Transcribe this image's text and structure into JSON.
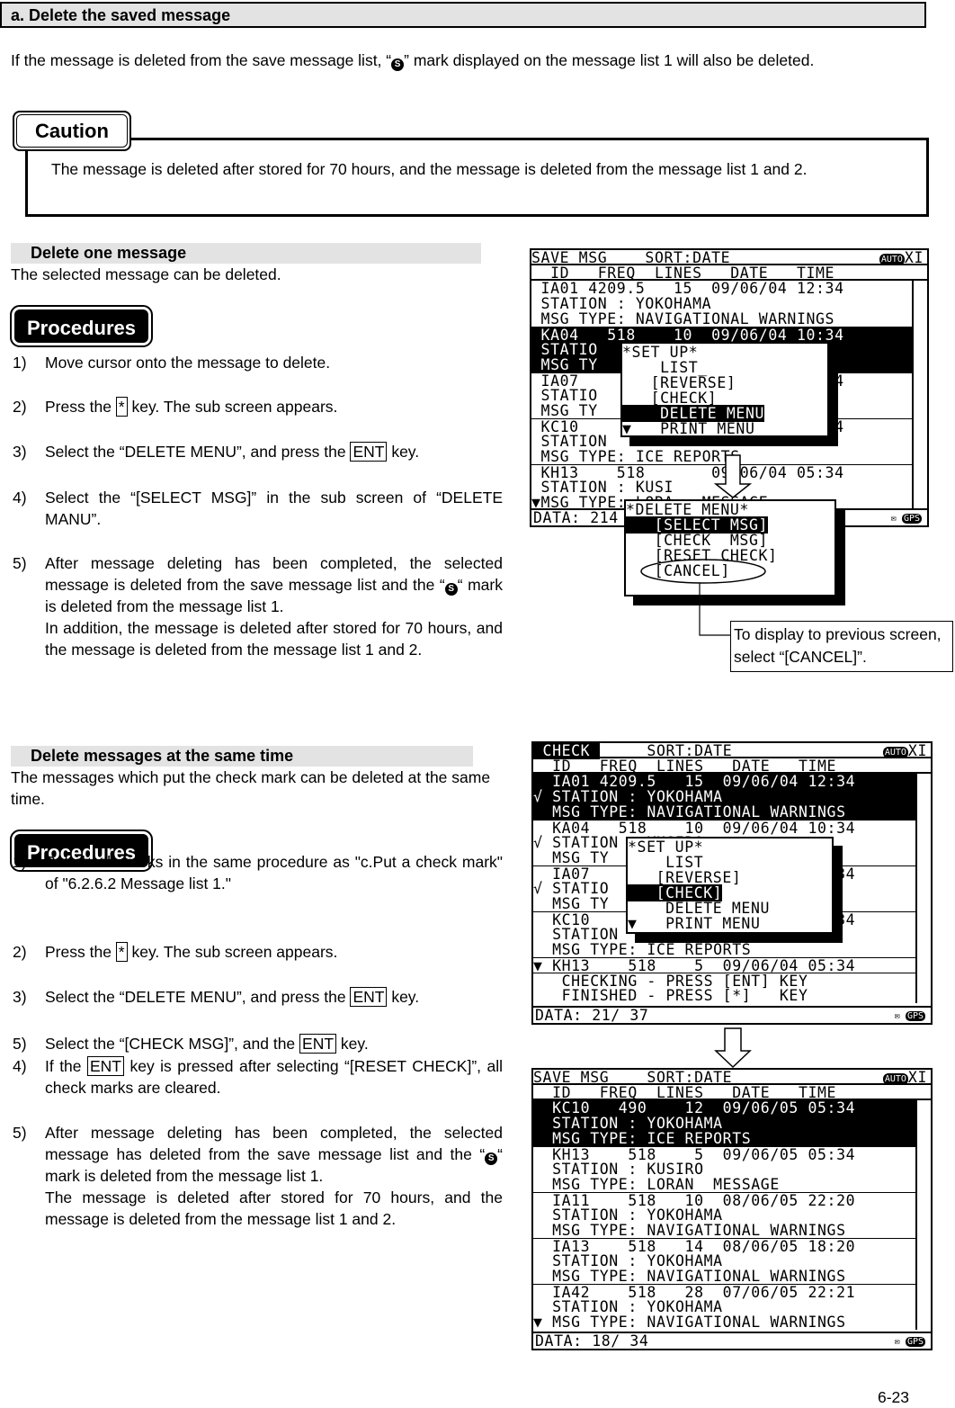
{
  "section_title": "a. Delete the saved message",
  "intro": {
    "before": "If the message is deleted from the save message list, “",
    "mark": "S",
    "after": "” mark displayed on the message list 1 will also be deleted."
  },
  "caution": {
    "label": "Caution",
    "text": "The message is deleted after stored for 70 hours, and the message is deleted from the message list 1 and 2."
  },
  "delete_one": {
    "heading": "Delete one message",
    "desc": "The selected message can be deleted.",
    "procedures_label": "Procedures",
    "steps": [
      {
        "num": "1)",
        "text": "Move cursor onto the message to delete."
      },
      {
        "num": "2)",
        "pre": "Press the ",
        "key": "*",
        "post": " key. The sub screen appears."
      },
      {
        "num": "3)",
        "pre": "Select the “DELETE MENU”, and press the ",
        "key": "ENT",
        "post": " key."
      },
      {
        "num": "4)",
        "text": "Select the “[SELECT MSG]” in the sub screen of “DELETE MANU”."
      },
      {
        "num": "5)",
        "pre": "After message deleting has been completed, the selected message is deleted from the save message list and the “",
        "post": "“ mark is deleted from the message list 1.",
        "extra": "In addition, the message is deleted after stored for 70 hours, and the message is deleted from the message list 1 and 2."
      }
    ]
  },
  "delete_multi": {
    "heading": "Delete messages at the same time",
    "desc": "The messages which put the check mark can be deleted at the same time.",
    "procedures_label": "Procedures",
    "steps": [
      {
        "num": "1)",
        "text": "Put check marks in the same procedure as \"c.Put a check mark\" of \"6.2.6.2 Message list 1.\""
      },
      {
        "num": "2)",
        "pre": "Press the ",
        "key": "*",
        "post": " key. The sub screen appears."
      },
      {
        "num": "3)",
        "pre": "Select the “DELETE MENU”, and press the ",
        "key": "ENT",
        "post": " key."
      },
      {
        "num": "5)",
        "pre": "Select the “[CHECK MSG]”, and the ",
        "key": "ENT",
        "post": " key."
      },
      {
        "num": "4)",
        "pre": "If the ",
        "key": "ENT",
        "post": " key is pressed after selecting “[RESET CHECK]”, all check marks are cleared."
      },
      {
        "num": "5)",
        "pre": "After message deleting has been completed, the selected message has deleted from the save message list and the “",
        "post": "“ mark is deleted from the message list 1.",
        "extra": "The message is deleted after stored for 70 hours, and the message is deleted from the message list 1 and 2."
      }
    ]
  },
  "screens": [
    {
      "title_inv": "",
      "title": "SAVE MSG    SORT:DATE",
      "auto": "AUTO",
      "mode": "XI",
      "header": "  ID   FREQ  LINES   DATE   TIME",
      "rows": [
        {
          "t": " IA01 4209.5   15  09/06/04 12:34"
        },
        {
          "t": " STATION : YOKOHAMA"
        },
        {
          "t": " MSG TYPE: NAVIGATIONAL WARNINGS"
        },
        {
          "t": " KA04   518    10  09/06/04 10:34",
          "inv": true,
          "sep": true
        },
        {
          "t": " STATIO",
          "inv": true
        },
        {
          "t": " MSG TY                  RNINGS",
          "inv": true
        },
        {
          "t": " IA07                       09:34",
          "sep": true
        },
        {
          "t": " STATIO"
        },
        {
          "t": " MSG TY                  RNINGS"
        },
        {
          "t": " KC10                       05:34",
          "sep": true
        },
        {
          "t": " STATION"
        },
        {
          "t": " MSG TYPE: ICE REPORTS"
        },
        {
          "t": " KH13    518       09/06/04 05:34",
          "sep": true
        },
        {
          "t": " STATION : KUSI"
        },
        {
          "t": "▼MSG TYPE: LORA   MESSAGE"
        }
      ],
      "footer": "DATA: 214",
      "gps": "GPS"
    },
    {
      "title_inv": " CHECK ",
      "title": "     SORT:DATE",
      "auto": "AUTO",
      "mode": "XI",
      "header": "  ID   FREQ  LINES   DATE   TIME",
      "rows": [
        {
          "t": "  IA01 4209.5   15  09/06/04 12:34",
          "inv": true
        },
        {
          "t": "√ STATION : YOKOHAMA",
          "inv": true
        },
        {
          "t": "  MSG TYPE: NAVIGATIONAL WARNINGS",
          "inv": true
        },
        {
          "t": "  KA04   518    10  09/06/04 10:34",
          "sep": true
        },
        {
          "t": "√ STATION : KUSIRO"
        },
        {
          "t": "  MSG TY                  RNINGS"
        },
        {
          "t": "  IA07                       09:34",
          "sep": true
        },
        {
          "t": "√ STATIO"
        },
        {
          "t": "  MSG TY                  RNINGS"
        },
        {
          "t": "  KC10                       05:34",
          "sep": true
        },
        {
          "t": "  STATION"
        },
        {
          "t": "  MSG TYPE: ICE REPORTS"
        },
        {
          "t": "▼ KH13    518    5  09/06/04 05:34",
          "sep": true
        },
        {
          "t": "   CHECKING - PRESS [ENT] KEY",
          "sep": true
        },
        {
          "t": "   FINISHED - PRESS [*]   KEY"
        }
      ],
      "footer": "DATA: 21/ 37",
      "gps": "GPS"
    },
    {
      "title_inv": "",
      "title": "SAVE MSG    SORT:DATE",
      "auto": "AUTO",
      "mode": "XI",
      "header": "  ID   FREQ  LINES   DATE   TIME",
      "rows": [
        {
          "t": "  KC10   490    12  09/06/05 05:34",
          "inv": true
        },
        {
          "t": "  STATION : YOKOHAMA",
          "inv": true
        },
        {
          "t": "  MSG TYPE: ICE REPORTS",
          "inv": true
        },
        {
          "t": "  KH13    518    5  09/06/05 05:34",
          "sep": true
        },
        {
          "t": "  STATION : KUSIRO"
        },
        {
          "t": "  MSG TYPE: LORAN  MESSAGE"
        },
        {
          "t": "  IA11    518   10  08/06/05 22:20",
          "sep": true
        },
        {
          "t": "  STATION : YOKOHAMA"
        },
        {
          "t": "  MSG TYPE: NAVIGATIONAL WARNINGS"
        },
        {
          "t": "  IA13    518   14  08/06/05 18:20",
          "sep": true
        },
        {
          "t": "  STATION : YOKOHAMA"
        },
        {
          "t": "  MSG TYPE: NAVIGATIONAL WARNINGS"
        },
        {
          "t": "  IA42    518   28  07/06/05 22:21",
          "sep": true
        },
        {
          "t": "  STATION : YOKOHAMA"
        },
        {
          "t": "▼ MSG TYPE: NAVIGATIONAL WARNINGS"
        }
      ],
      "footer": "DATA: 18/ 34",
      "gps": "GPS"
    }
  ],
  "popups": [
    {
      "lines": [
        {
          "t": "*SET UP*"
        },
        {
          "t": "    LIST_"
        },
        {
          "t": "   [REVERSE]"
        },
        {
          "t": "   [CHECK]"
        },
        {
          "t": "    DELETE MENU",
          "sel": true
        },
        {
          "t": "▼   PRINT MENU"
        }
      ]
    },
    {
      "lines": [
        {
          "t": "*DELETE MENU*"
        },
        {
          "t": "   [SELECT MSG]",
          "sel": true
        },
        {
          "t": "   [CHECK  MSG]"
        },
        {
          "t": "   [RESET CHECK]"
        },
        {
          "t": "   [CANCEL]"
        }
      ]
    },
    {
      "lines": [
        {
          "t": "*SET UP*"
        },
        {
          "t": "    LIST"
        },
        {
          "t": "   [REVERSE]"
        },
        {
          "t": "   [CHECK]",
          "sel": true
        },
        {
          "t": "    DELETE MENU"
        },
        {
          "t": "▼   PRINT MENU"
        }
      ]
    }
  ],
  "callout": "To display to previous screen, select “[CANCEL]”.",
  "page_number": "6-23"
}
